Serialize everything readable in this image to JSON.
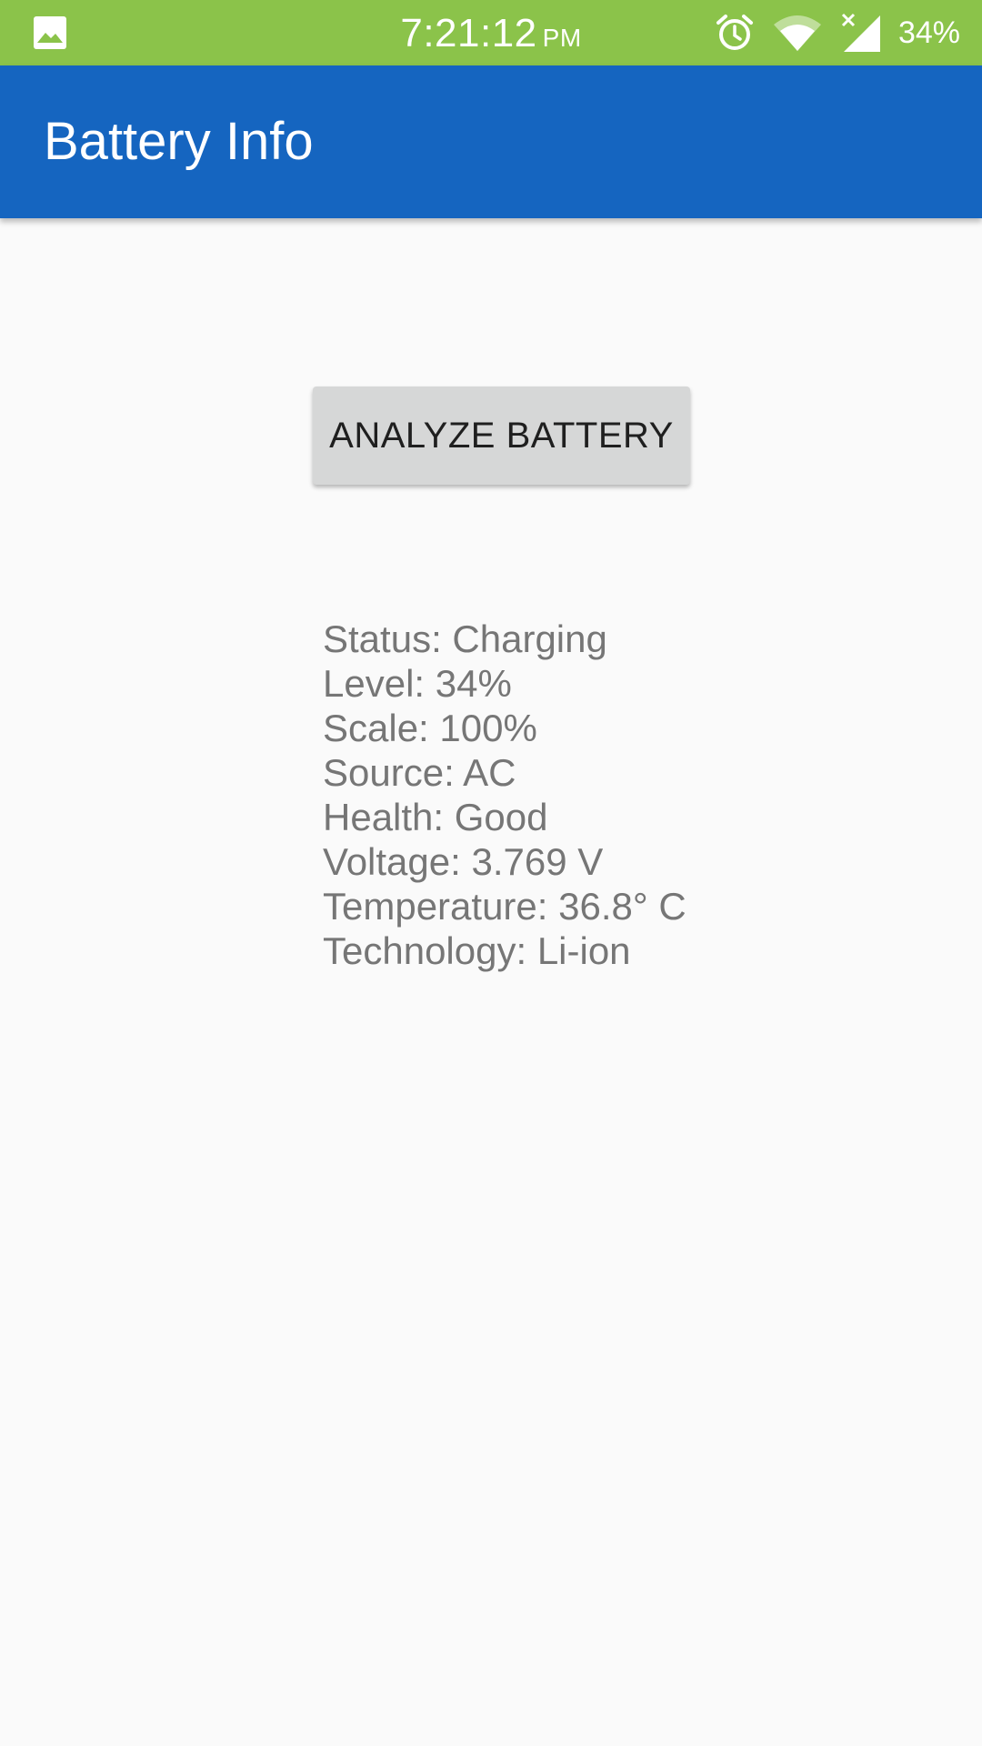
{
  "status_bar": {
    "time": "7:21:12",
    "ampm": "PM",
    "battery": "34%",
    "icons": [
      "image-icon",
      "alarm-icon",
      "wifi-icon",
      "signal-icon"
    ]
  },
  "app_bar": {
    "title": "Battery Info"
  },
  "main": {
    "analyze_button_label": "ANALYZE BATTERY",
    "info_lines": [
      "Status: Charging",
      "Level: 34%",
      "Scale: 100%",
      "Source: AC",
      "Health: Good",
      "Voltage: 3.769 V",
      "Temperature: 36.8° C",
      "Technology: Li-ion"
    ]
  },
  "colors": {
    "status_bar": "#8bc34a",
    "app_bar": "#1565c0",
    "button": "#d6d7d7",
    "background": "#fafafa",
    "info_text": "#767676"
  }
}
